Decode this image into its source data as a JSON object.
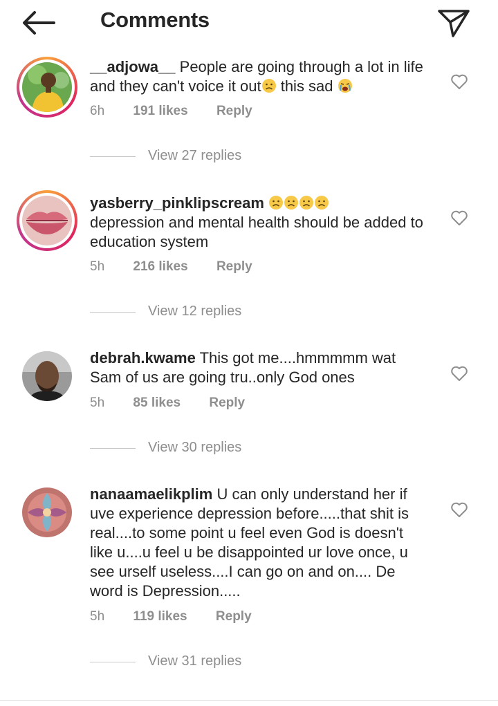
{
  "header": {
    "title": "Comments",
    "back_icon": "arrow-left-icon",
    "send_icon": "paper-plane-icon"
  },
  "comments": [
    {
      "username": "__adjowa__",
      "text": "People are going through a lot in life and they can't voice it out",
      "text_after": "this sad",
      "emojis": [
        "frowning-face",
        "crying-face"
      ],
      "time": "6h",
      "likes": "191 likes",
      "reply": "Reply",
      "view_replies": "View 27 replies",
      "has_story_ring": true
    },
    {
      "username": "yasberry_pinklipscream",
      "emojis": [
        "frowning-face",
        "frowning-face",
        "frowning-face",
        "frowning-face"
      ],
      "text": "depression and mental health should be added to education system",
      "time": "5h",
      "likes": "216 likes",
      "reply": "Reply",
      "view_replies": "View 12 replies",
      "has_story_ring": true
    },
    {
      "username": "debrah.kwame",
      "text": "This got me....hmmmmm wat Sam of us are going tru..only God ones",
      "time": "5h",
      "likes": "85 likes",
      "reply": "Reply",
      "view_replies": "View 30 replies",
      "has_story_ring": false
    },
    {
      "username": "nanaamaelikplim",
      "text": "U can only understand her if uve experience depression before.....that shit is real....to some point u feel even God is doesn't like u....u feel u be disappointed ur love once, u see urself useless....I can go on and on.... De word is Depression.....",
      "time": "5h",
      "likes": "119 likes",
      "reply": "Reply",
      "view_replies": "View 31 replies",
      "has_story_ring": false
    }
  ],
  "colors": {
    "text_primary": "#262626",
    "text_secondary": "#8e8e8e",
    "story_ring": "#e0245e",
    "emoji_yellow": "#f7c948"
  }
}
